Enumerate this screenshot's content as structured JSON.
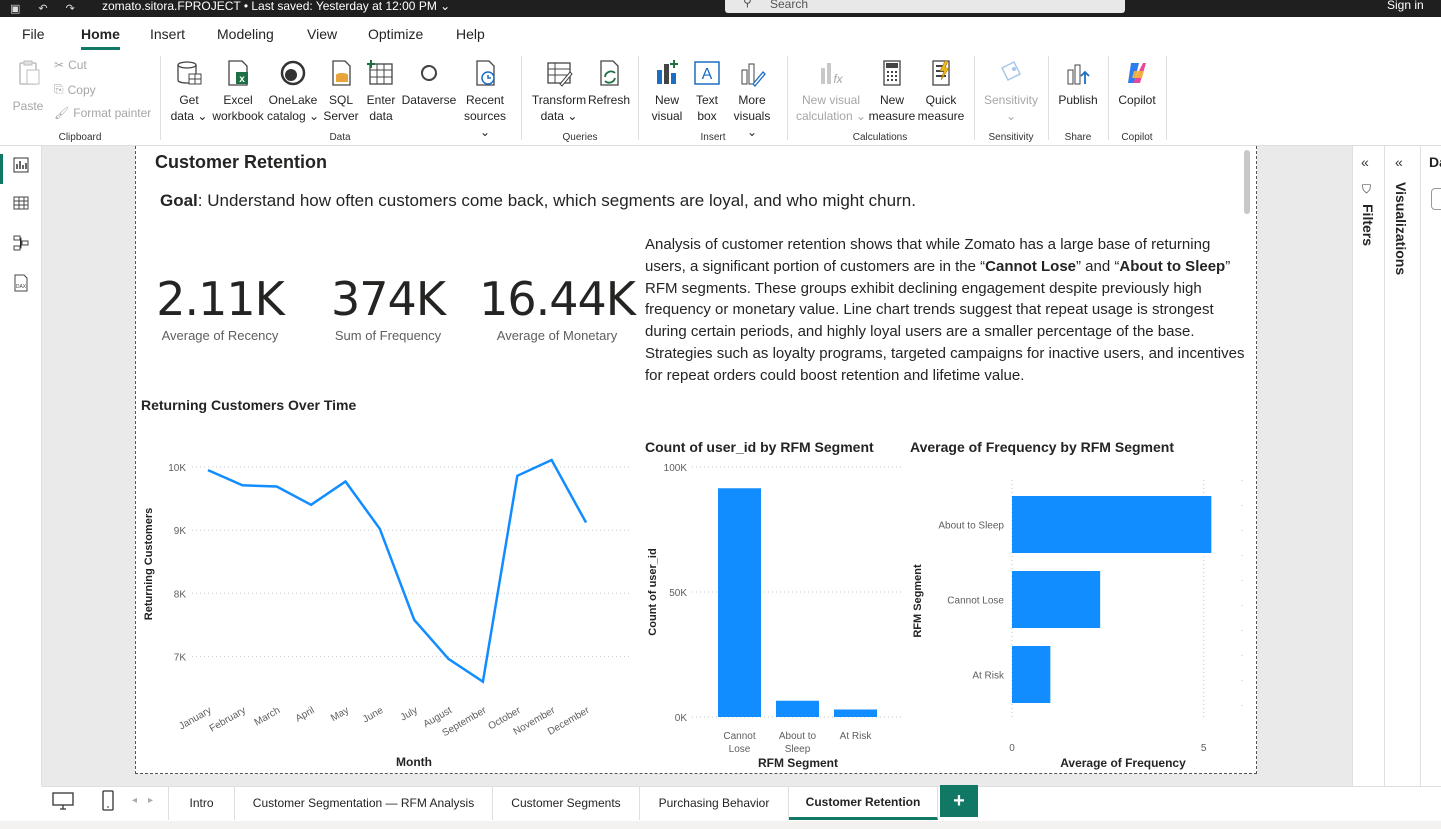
{
  "titlebar": {
    "file_title": "zomato.sitora.FPROJECT",
    "saved": "• Last saved: Yesterday at 12:00 PM",
    "search_placeholder": "Search",
    "signin": "Sign in"
  },
  "menu": {
    "tabs": [
      "File",
      "Home",
      "Insert",
      "Modeling",
      "View",
      "Optimize",
      "Help"
    ],
    "active": "Home"
  },
  "ribbon": {
    "clipboard": {
      "paste": "Paste",
      "cut": "Cut",
      "copy": "Copy",
      "format_painter": "Format painter",
      "label": "Clipboard"
    },
    "data": {
      "label": "Data",
      "buttons": [
        {
          "l1": "Get",
          "l2": "data ⌄"
        },
        {
          "l1": "Excel",
          "l2": "workbook"
        },
        {
          "l1": "OneLake",
          "l2": "catalog ⌄"
        },
        {
          "l1": "SQL",
          "l2": "Server"
        },
        {
          "l1": "Enter",
          "l2": "data"
        },
        {
          "l1": "Dataverse",
          "l2": ""
        },
        {
          "l1": "Recent",
          "l2": "sources ⌄"
        }
      ]
    },
    "queries": {
      "label": "Queries",
      "transform_l1": "Transform",
      "transform_l2": "data ⌄",
      "refresh": "Refresh"
    },
    "insert": {
      "label": "Insert",
      "buttons": [
        {
          "l1": "New",
          "l2": "visual"
        },
        {
          "l1": "Text",
          "l2": "box"
        },
        {
          "l1": "More",
          "l2": "visuals ⌄"
        }
      ]
    },
    "calculations": {
      "label": "Calculations",
      "buttons": [
        {
          "l1": "New visual",
          "l2": "calculation ⌄"
        },
        {
          "l1": "New",
          "l2": "measure"
        },
        {
          "l1": "Quick",
          "l2": "measure"
        }
      ]
    },
    "sensitivity": {
      "label": "Sensitivity",
      "l1": "Sensitivity",
      "l2": "⌄"
    },
    "share": {
      "label": "Share",
      "publish": "Publish"
    },
    "copilot": {
      "label": "Copilot",
      "btn": "Copilot"
    }
  },
  "report": {
    "title": "Customer Retention",
    "goal_label": "Goal",
    "goal_text": ": Understand how often customers come back, which segments are loyal, and who might churn.",
    "kpis": [
      {
        "value": "2.11K",
        "label": "Average of Recency"
      },
      {
        "value": "374K",
        "label": "Sum of Frequency"
      },
      {
        "value": "16.44K",
        "label": "Average of Monetary"
      }
    ],
    "analysis": {
      "p1": "Analysis of customer retention shows that while Zomato has a large base of returning users, a significant portion of customers are in the “",
      "b1": "Cannot Lose",
      "p2": "” and “",
      "b2": "About to Sleep",
      "p3": "” RFM segments. These groups exhibit declining engagement despite previously high frequency or monetary value. Line chart trends suggest that repeat usage is strongest during certain periods, and highly loyal users are a smaller percentage of the base. Strategies such as loyalty programs, targeted campaigns for inactive users, and incentives for repeat orders could boost retention and lifetime value."
    }
  },
  "chart_data": [
    {
      "type": "line",
      "title": "Returning Customers Over Time",
      "xlabel": "Month",
      "ylabel": "Returning Customers",
      "categories": [
        "January",
        "February",
        "March",
        "April",
        "May",
        "June",
        "July",
        "August",
        "September",
        "October",
        "November",
        "December"
      ],
      "values": [
        9950,
        9710,
        9690,
        9400,
        9770,
        9020,
        7580,
        6960,
        6600,
        9860,
        10110,
        9120
      ],
      "ylim": [
        6500,
        10300
      ],
      "yticks": [
        7000,
        8000,
        9000,
        10000
      ],
      "ytick_labels": [
        "7K",
        "8K",
        "9K",
        "10K"
      ],
      "color": "#118DFF",
      "grid": true
    },
    {
      "type": "bar",
      "title": "Count of user_id by RFM Segment",
      "xlabel": "RFM Segment",
      "ylabel": "Count of user_id",
      "categories": [
        "Cannot Lose",
        "About to Sleep",
        "At Risk"
      ],
      "values": [
        91500,
        6500,
        3000
      ],
      "ylim": [
        0,
        100000
      ],
      "yticks": [
        0,
        50000,
        100000
      ],
      "ytick_labels": [
        "0K",
        "50K",
        "100K"
      ],
      "color": "#118DFF",
      "grid": true
    },
    {
      "type": "bar",
      "orientation": "horizontal",
      "title": "Average of Frequency by RFM Segment",
      "xlabel": "Average of Frequency",
      "ylabel": "RFM Segment",
      "categories": [
        "About to Sleep",
        "Cannot Lose",
        "At Risk"
      ],
      "values": [
        5.2,
        2.3,
        1.0
      ],
      "xlim": [
        0,
        6
      ],
      "xticks": [
        0,
        5
      ],
      "xtick_labels": [
        "0",
        "5"
      ],
      "color": "#118DFF",
      "grid": true
    }
  ],
  "panes": {
    "filters": "Filters",
    "visualizations": "Visualizations",
    "data": "Da"
  },
  "pages": {
    "tabs": [
      "Intro",
      "Customer Segmentation — RFM Analysis",
      "Customer Segments",
      "Purchasing Behavior",
      "Customer Retention"
    ],
    "active": "Customer Retention",
    "add": "+"
  }
}
